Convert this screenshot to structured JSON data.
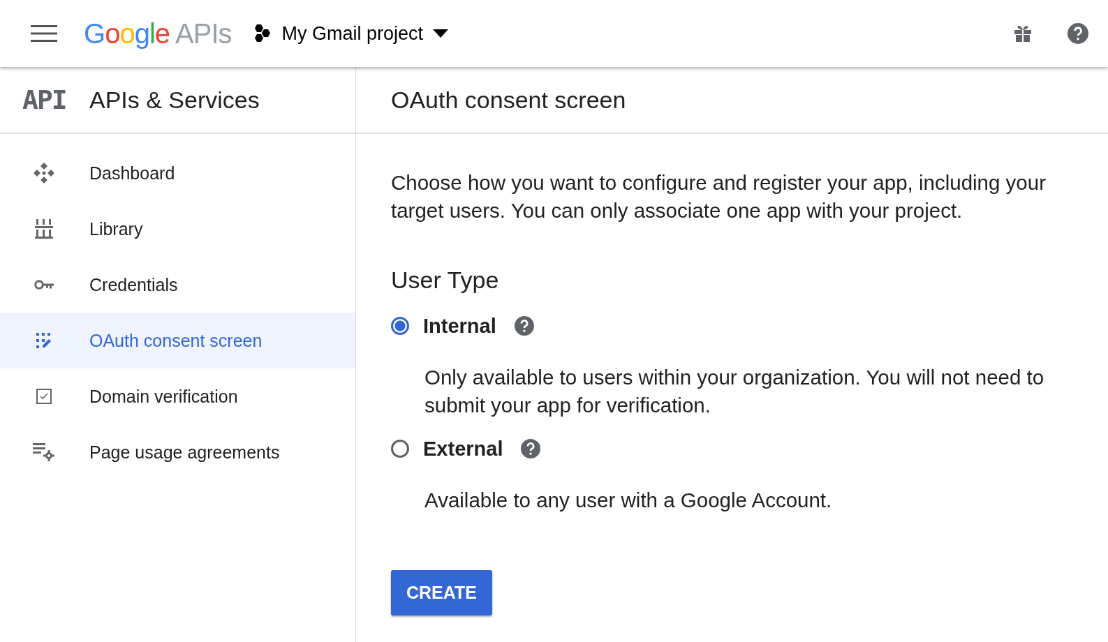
{
  "topbar": {
    "logo_brand": "Google",
    "logo_product": "APIs",
    "project": "My Gmail project"
  },
  "sidebar": {
    "logo": "API",
    "title": "APIs & Services",
    "items": [
      {
        "label": "Dashboard",
        "kind": "dashboard",
        "selected": false
      },
      {
        "label": "Library",
        "kind": "library",
        "selected": false
      },
      {
        "label": "Credentials",
        "kind": "key",
        "selected": false
      },
      {
        "label": "OAuth consent screen",
        "kind": "consent",
        "selected": true
      },
      {
        "label": "Domain verification",
        "kind": "checkbox",
        "selected": false
      },
      {
        "label": "Page usage agreements",
        "kind": "settings",
        "selected": false
      }
    ]
  },
  "main": {
    "title": "OAuth consent screen",
    "intro": "Choose how you want to configure and register your app, including your target users. You can only associate one app with your project.",
    "section_title": "User Type",
    "options": [
      {
        "label": "Internal",
        "selected": true,
        "description": "Only available to users within your organization. You will not need to submit your app for verification."
      },
      {
        "label": "External",
        "selected": false,
        "description": "Available to any user with a Google Account."
      }
    ],
    "button": "CREATE"
  }
}
